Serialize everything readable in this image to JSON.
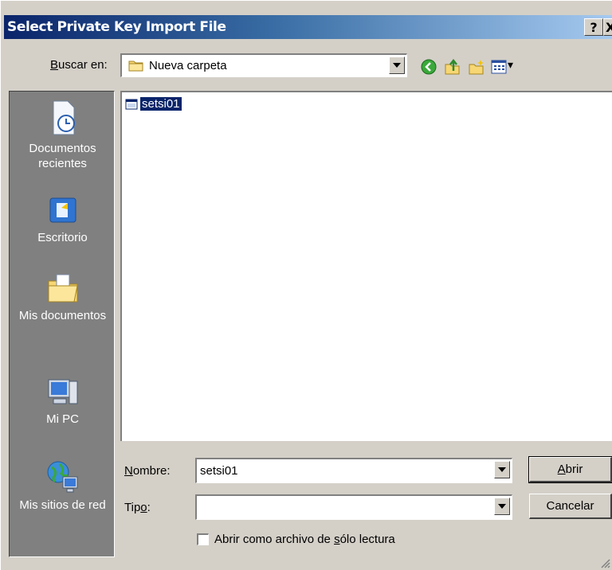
{
  "window": {
    "title": "Select Private Key Import File",
    "help_glyph": "?",
    "close_glyph": "X"
  },
  "lookin": {
    "label_prefix": "",
    "label_accel": "B",
    "label_rest": "uscar en:",
    "value": "Nueva carpeta"
  },
  "toolbar": {
    "icons": [
      "back-icon",
      "up-folder-icon",
      "new-folder-icon",
      "view-menu-icon"
    ],
    "view_menu_arrow": "▾"
  },
  "places": [
    {
      "name": "recent-documents",
      "label": "Documentos recientes",
      "icon": "clock-document-icon"
    },
    {
      "name": "desktop",
      "label": "Escritorio",
      "icon": "desktop-icon"
    },
    {
      "name": "my-documents",
      "label": "Mis documentos",
      "icon": "folder-documents-icon"
    },
    {
      "name": "my-computer",
      "label": "Mi PC",
      "icon": "computer-icon"
    },
    {
      "name": "network-places",
      "label": "Mis sitios de red",
      "icon": "network-icon"
    }
  ],
  "files": [
    {
      "name": "setsi01",
      "icon": "key-file-icon",
      "selected": true
    }
  ],
  "filename": {
    "label_accel": "N",
    "label_rest": "ombre:",
    "value": "setsi01"
  },
  "filetype": {
    "label_prefix": "Tip",
    "label_accel": "o",
    "label_rest": ":",
    "value": ""
  },
  "buttons": {
    "open_accel": "A",
    "open_rest": "brir",
    "cancel": "Cancelar"
  },
  "readonly": {
    "prefix": "Abrir como archivo de ",
    "accel": "s",
    "suffix": "ólo lectura",
    "checked": false
  },
  "colors": {
    "titlebar_start": "#0a246a",
    "titlebar_end": "#a6caf0",
    "selection": "#0a246a",
    "face": "#d4d0c8"
  }
}
